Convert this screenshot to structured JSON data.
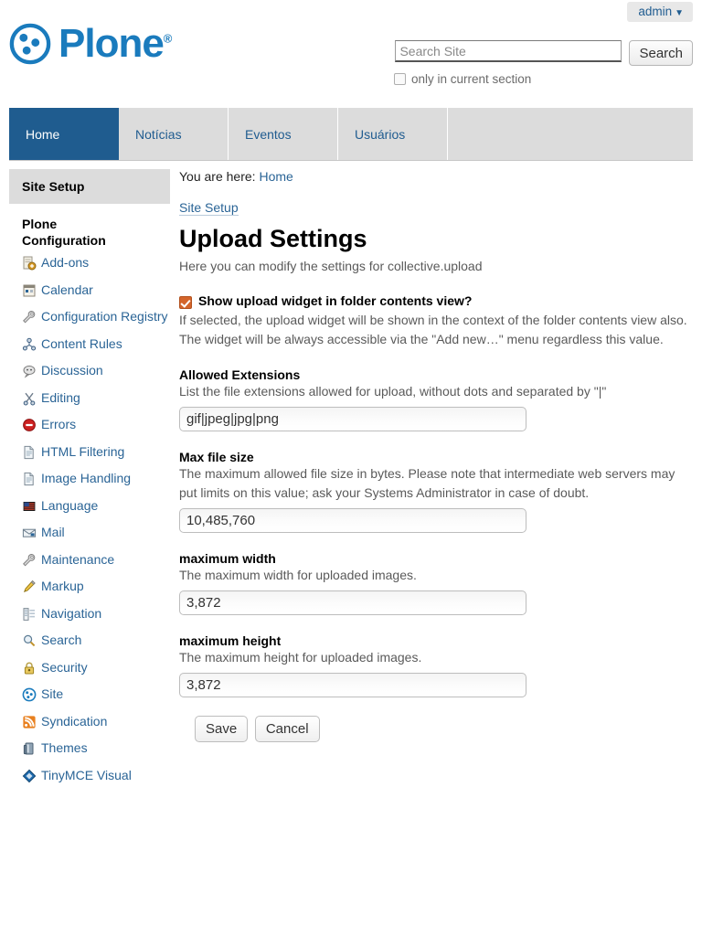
{
  "personal_bar": {
    "user": "admin",
    "caret": "▼",
    "icon": "chevron-down-icon"
  },
  "brand": {
    "name": "Plone",
    "registered_mark": "®",
    "logo_icon": "plone-logo-icon"
  },
  "search": {
    "placeholder": "Search Site",
    "value": "",
    "button_label": "Search",
    "scope_label": "only in current section",
    "scope_checked": false,
    "icon": "search-icon"
  },
  "nav": {
    "tabs": [
      {
        "label": "Home",
        "selected": true
      },
      {
        "label": "Notícias",
        "selected": false
      },
      {
        "label": "Eventos",
        "selected": false
      },
      {
        "label": "Usuários",
        "selected": false
      }
    ]
  },
  "sidebar": {
    "header": "Site Setup",
    "section_title": "Plone Configuration",
    "items": [
      {
        "label": "Add-ons",
        "icon": "addons-icon"
      },
      {
        "label": "Calendar",
        "icon": "calendar-icon"
      },
      {
        "label": "Configuration Registry",
        "icon": "wrench-icon"
      },
      {
        "label": "Content Rules",
        "icon": "content-rules-icon"
      },
      {
        "label": "Discussion",
        "icon": "discussion-icon"
      },
      {
        "label": "Editing",
        "icon": "scissors-icon"
      },
      {
        "label": "Errors",
        "icon": "error-icon"
      },
      {
        "label": "HTML Filtering",
        "icon": "document-icon"
      },
      {
        "label": "Image Handling",
        "icon": "document-icon"
      },
      {
        "label": "Language",
        "icon": "flag-icon"
      },
      {
        "label": "Mail",
        "icon": "envelope-icon"
      },
      {
        "label": "Maintenance",
        "icon": "wrench-icon"
      },
      {
        "label": "Markup",
        "icon": "pencil-icon"
      },
      {
        "label": "Navigation",
        "icon": "navigation-icon"
      },
      {
        "label": "Search",
        "icon": "magnifier-icon"
      },
      {
        "label": "Security",
        "icon": "lock-icon"
      },
      {
        "label": "Site",
        "icon": "plone-logo-icon"
      },
      {
        "label": "Syndication",
        "icon": "rss-icon"
      },
      {
        "label": "Themes",
        "icon": "themes-icon"
      },
      {
        "label": "TinyMCE Visual",
        "icon": "diamond-icon"
      }
    ]
  },
  "content": {
    "breadcrumb_prefix": "You are here:",
    "breadcrumb_home": "Home",
    "setup_link": "Site Setup",
    "title": "Upload Settings",
    "description": "Here you can modify the settings for collective.upload",
    "fields": [
      {
        "type": "checkbox",
        "label": "Show upload widget in folder contents view?",
        "checked": true,
        "help": "If selected, the upload widget will be shown in the context of the folder contents view also. The widget will be always accessible via the \"Add new…\" menu regardless this value."
      },
      {
        "type": "text",
        "label": "Allowed Extensions",
        "help": "List the file extensions allowed for upload, without dots and separated by \"|\"",
        "value": "gif|jpeg|jpg|png"
      },
      {
        "type": "text",
        "label": "Max file size",
        "help": "The maximum allowed file size in bytes. Please note that intermediate web servers may put limits on this value; ask your Systems Administrator in case of doubt.",
        "value": "10,485,760"
      },
      {
        "type": "text",
        "label": "maximum width",
        "help": "The maximum width for uploaded images.",
        "value": "3,872"
      },
      {
        "type": "text",
        "label": "maximum height",
        "help": "The maximum height for uploaded images.",
        "value": "3,872"
      }
    ],
    "save_label": "Save",
    "cancel_label": "Cancel"
  },
  "colors": {
    "brand_blue": "#1a7bbd",
    "link_blue": "#2a6496",
    "nav_selected": "#1f5c8f",
    "nav_bg": "#dcdcdc",
    "checkbox_orange": "#d4652b"
  }
}
